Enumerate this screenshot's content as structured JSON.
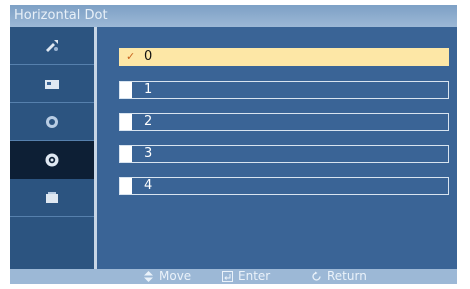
{
  "window": {
    "title": "Horizontal Dot"
  },
  "sidebar": {
    "items": [
      {
        "icon": "input-icon",
        "active": false
      },
      {
        "icon": "picture-icon",
        "active": false
      },
      {
        "icon": "sound-icon",
        "active": false
      },
      {
        "icon": "setup-gear-icon",
        "active": true
      },
      {
        "icon": "multi-control-icon",
        "active": false
      }
    ]
  },
  "options": [
    {
      "label": "0",
      "selected": true,
      "check": "✓"
    },
    {
      "label": "1",
      "selected": false
    },
    {
      "label": "2",
      "selected": false
    },
    {
      "label": "3",
      "selected": false
    },
    {
      "label": "4",
      "selected": false
    }
  ],
  "footer": {
    "move_label": "Move",
    "enter_label": "Enter",
    "return_label": "Return"
  },
  "colors": {
    "panel": "#3a6496",
    "selected_row": "#fde7a6",
    "title_bar": "#9cb8d6"
  }
}
